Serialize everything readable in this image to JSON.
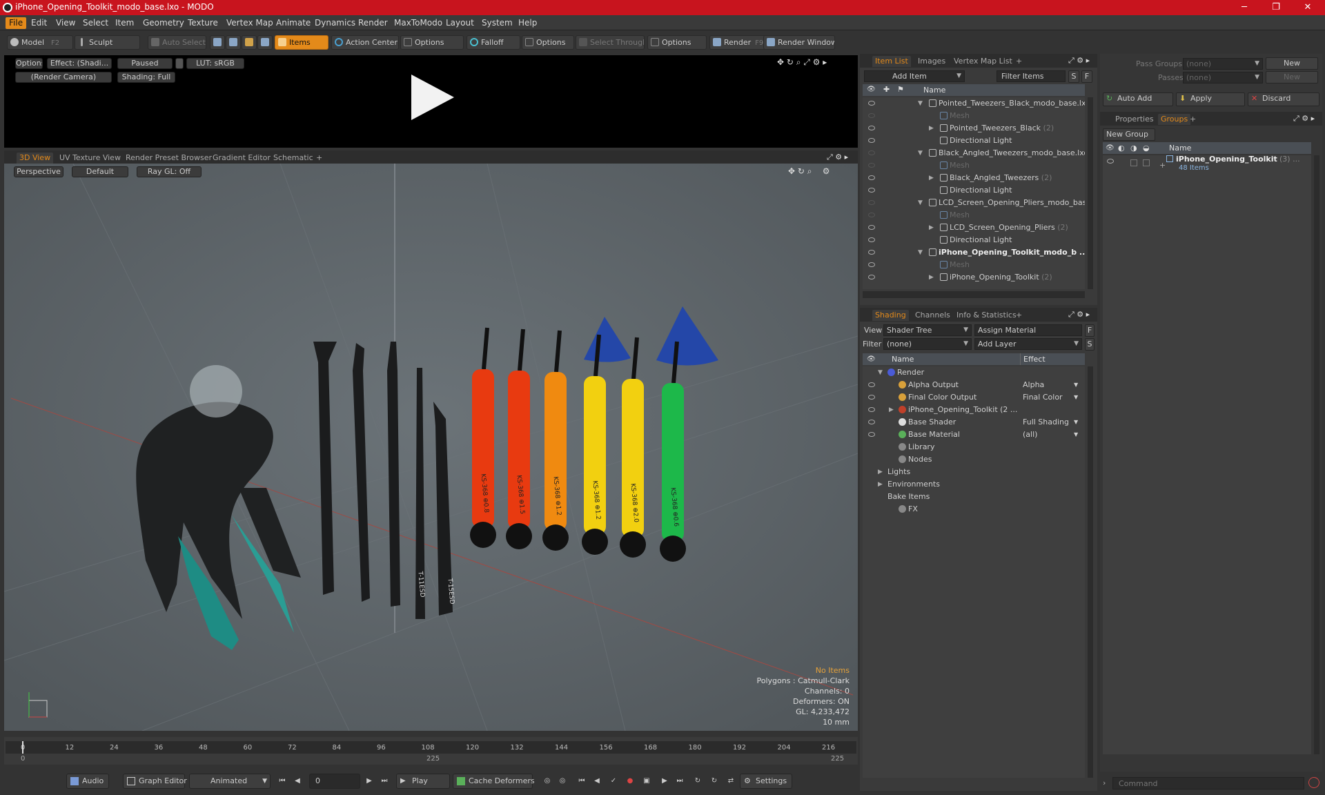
{
  "title": "iPhone_Opening_Toolkit_modo_base.lxo - MODO",
  "window": {
    "min": "─",
    "max": "❐",
    "close": "✕"
  },
  "menu": [
    "File",
    "Edit",
    "View",
    "Select",
    "Item",
    "Geometry",
    "Texture",
    "Vertex Map",
    "Animate",
    "Dynamics",
    "Render",
    "MaxToModo",
    "Layout",
    "System",
    "Help"
  ],
  "toolbar": {
    "model": "Model",
    "model_key": "F2",
    "sculpt": "Sculpt",
    "auto_select": "Auto Select",
    "items": "Items",
    "action_center": "Action Center",
    "options1": "Options",
    "falloff": "Falloff",
    "options2": "Options",
    "select_through": "Select Through",
    "options3": "Options",
    "render": "Render",
    "render_key": "F9",
    "render_window": "Render Window"
  },
  "preview": {
    "options": "Options",
    "effect": "Effect: (Shadi...",
    "paused": "Paused",
    "lut": "LUT: sRGB",
    "camera": "(Render Camera)",
    "shading": "Shading: Full"
  },
  "viewtabs": [
    "3D View",
    "UV Texture View",
    "Render Preset Browser",
    "Gradient Editor",
    "Schematic",
    "+"
  ],
  "viewport": {
    "perspective": "Perspective",
    "default": "Default",
    "raygl": "Ray GL: Off"
  },
  "hud": {
    "no_items": "No Items",
    "polygons": "Polygons : Catmull-Clark",
    "channels": "Channels: 0",
    "deformers": "Deformers: ON",
    "gl": "GL: 4,233,472",
    "scale": "10 mm"
  },
  "tool_labels": [
    "T-11ESD",
    "T-15ESD",
    "KS-368 ⊕0.8",
    "KS-368 ⊕1.5",
    "KS-368 ⊕1.2",
    "KS-368 ⊕1.2",
    "KS-368 ⊕2.0",
    "KS-368 ⊕0.6"
  ],
  "timeline": {
    "ticks": [
      "0",
      "12",
      "24",
      "36",
      "48",
      "60",
      "72",
      "84",
      "96",
      "108",
      "120",
      "132",
      "144",
      "156",
      "168",
      "180",
      "192",
      "204",
      "216"
    ],
    "start": "0",
    "mid": "225",
    "end": "225"
  },
  "bottom": {
    "audio": "Audio",
    "graph_editor": "Graph Editor",
    "animated": "Animated",
    "frame": "0",
    "play": "Play",
    "cache_deformers": "Cache Deformers",
    "settings": "Settings"
  },
  "itemlist": {
    "tabs": [
      "Item List",
      "Images",
      "Vertex Map List",
      "+"
    ],
    "add_item": "Add Item",
    "filter_items": "Filter Items",
    "col_name": "Name",
    "rows": [
      {
        "label": "Pointed_Tweezers_Black_modo_base.lxo",
        "indent": 0,
        "exp": "▼",
        "bold": false,
        "dim": false,
        "eye": true,
        "count": ""
      },
      {
        "label": "Mesh",
        "indent": 1,
        "exp": "",
        "bold": false,
        "dim": true,
        "eye": false,
        "count": ""
      },
      {
        "label": "Pointed_Tweezers_Black",
        "indent": 1,
        "exp": "▶",
        "bold": false,
        "dim": false,
        "eye": true,
        "count": "(2)"
      },
      {
        "label": "Directional Light",
        "indent": 1,
        "exp": "",
        "bold": false,
        "dim": false,
        "eye": true,
        "count": ""
      },
      {
        "label": "Black_Angled_Tweezers_modo_base.lxo",
        "indent": 0,
        "exp": "▼",
        "bold": false,
        "dim": false,
        "eye": false,
        "count": ""
      },
      {
        "label": "Mesh",
        "indent": 1,
        "exp": "",
        "bold": false,
        "dim": true,
        "eye": false,
        "count": ""
      },
      {
        "label": "Black_Angled_Tweezers",
        "indent": 1,
        "exp": "▶",
        "bold": false,
        "dim": false,
        "eye": true,
        "count": "(2)"
      },
      {
        "label": "Directional Light",
        "indent": 1,
        "exp": "",
        "bold": false,
        "dim": false,
        "eye": true,
        "count": ""
      },
      {
        "label": "LCD_Screen_Opening_Pliers_modo_bas ...",
        "indent": 0,
        "exp": "▼",
        "bold": false,
        "dim": false,
        "eye": false,
        "count": ""
      },
      {
        "label": "Mesh",
        "indent": 1,
        "exp": "",
        "bold": false,
        "dim": true,
        "eye": false,
        "count": ""
      },
      {
        "label": "LCD_Screen_Opening_Pliers",
        "indent": 1,
        "exp": "▶",
        "bold": false,
        "dim": false,
        "eye": true,
        "count": "(2)"
      },
      {
        "label": "Directional Light",
        "indent": 1,
        "exp": "",
        "bold": false,
        "dim": false,
        "eye": true,
        "count": ""
      },
      {
        "label": "iPhone_Opening_Toolkit_modo_b ...",
        "indent": 0,
        "exp": "▼",
        "bold": true,
        "dim": false,
        "eye": true,
        "count": ""
      },
      {
        "label": "Mesh",
        "indent": 1,
        "exp": "",
        "bold": false,
        "dim": true,
        "eye": true,
        "count": ""
      },
      {
        "label": "iPhone_Opening_Toolkit",
        "indent": 1,
        "exp": "▶",
        "bold": false,
        "dim": false,
        "eye": true,
        "count": "(2)"
      }
    ]
  },
  "shading": {
    "tabs": [
      "Shading",
      "Channels",
      "Info & Statistics",
      "+"
    ],
    "view_label": "View",
    "view_value": "Shader Tree",
    "assign_material": "Assign Material",
    "filter_label": "Filter",
    "filter_value": "(none)",
    "add_layer": "Add Layer",
    "f": "F",
    "s": "S",
    "col_name": "Name",
    "col_effect": "Effect",
    "rows": [
      {
        "label": "Render",
        "effect": "",
        "indent": 0,
        "exp": "▼",
        "eye": false,
        "icon": "#4a5bd6"
      },
      {
        "label": "Alpha Output",
        "effect": "Alpha",
        "indent": 1,
        "exp": "",
        "eye": true,
        "icon": "#d8a03a"
      },
      {
        "label": "Final Color Output",
        "effect": "Final Color",
        "indent": 1,
        "exp": "",
        "eye": true,
        "icon": "#d8a03a"
      },
      {
        "label": "iPhone_Opening_Toolkit (2 ...",
        "effect": "",
        "indent": 1,
        "exp": "▶",
        "eye": true,
        "icon": "#c0402a"
      },
      {
        "label": "Base Shader",
        "effect": "Full Shading",
        "indent": 1,
        "exp": "",
        "eye": true,
        "icon": "#dddddd"
      },
      {
        "label": "Base Material",
        "effect": "(all)",
        "indent": 1,
        "exp": "",
        "eye": true,
        "icon": "#5ab05a"
      },
      {
        "label": "Library",
        "effect": "",
        "indent": 1,
        "exp": "",
        "eye": false,
        "icon": "#888888"
      },
      {
        "label": "Nodes",
        "effect": "",
        "indent": 1,
        "exp": "",
        "eye": false,
        "icon": "#888888"
      },
      {
        "label": "Lights",
        "effect": "",
        "indent": 0,
        "exp": "▶",
        "eye": false,
        "icon": ""
      },
      {
        "label": "Environments",
        "effect": "",
        "indent": 0,
        "exp": "▶",
        "eye": false,
        "icon": ""
      },
      {
        "label": "Bake Items",
        "effect": "",
        "indent": 0,
        "exp": "",
        "eye": false,
        "icon": ""
      },
      {
        "label": "FX",
        "effect": "",
        "indent": 1,
        "exp": "",
        "eye": false,
        "icon": "#888888"
      }
    ]
  },
  "groups": {
    "pass_groups_label": "Pass Groups",
    "pass_groups_value": "(none)",
    "passes_label": "Passes",
    "passes_value": "(none)",
    "new": "New",
    "new2": "New",
    "auto_add": "Auto Add",
    "apply": "Apply",
    "discard": "Discard",
    "tabs": [
      "Properties",
      "Groups",
      "+"
    ],
    "new_group": "New Group",
    "col_name": "Name",
    "group_name": "iPhone_Opening_Toolkit",
    "group_count": "(3) ...",
    "group_items": "48 Items"
  },
  "command": {
    "placeholder": "Command"
  }
}
